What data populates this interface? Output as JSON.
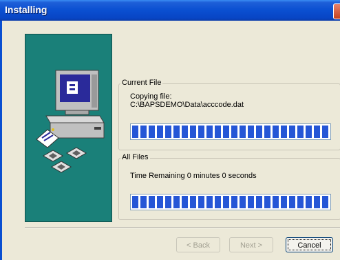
{
  "window": {
    "title": "Installing"
  },
  "current_file": {
    "group_label": "Current File",
    "status": "Copying file:",
    "path": "C:\\BAPSDEMO\\Data\\acccode.dat",
    "progress": 1.0
  },
  "all_files": {
    "group_label": "All Files",
    "time_remaining": "Time Remaining 0 minutes 0 seconds",
    "progress": 1.0
  },
  "buttons": {
    "back": "< Back",
    "next": "Next >",
    "cancel": "Cancel"
  },
  "colors": {
    "panel": "#1a8079",
    "progress_fill": "#2556d6",
    "titlebar": "#0a4fd1"
  },
  "icons": [
    "computer-icon",
    "document-icon",
    "floppy-disk-icon",
    "close-icon"
  ]
}
